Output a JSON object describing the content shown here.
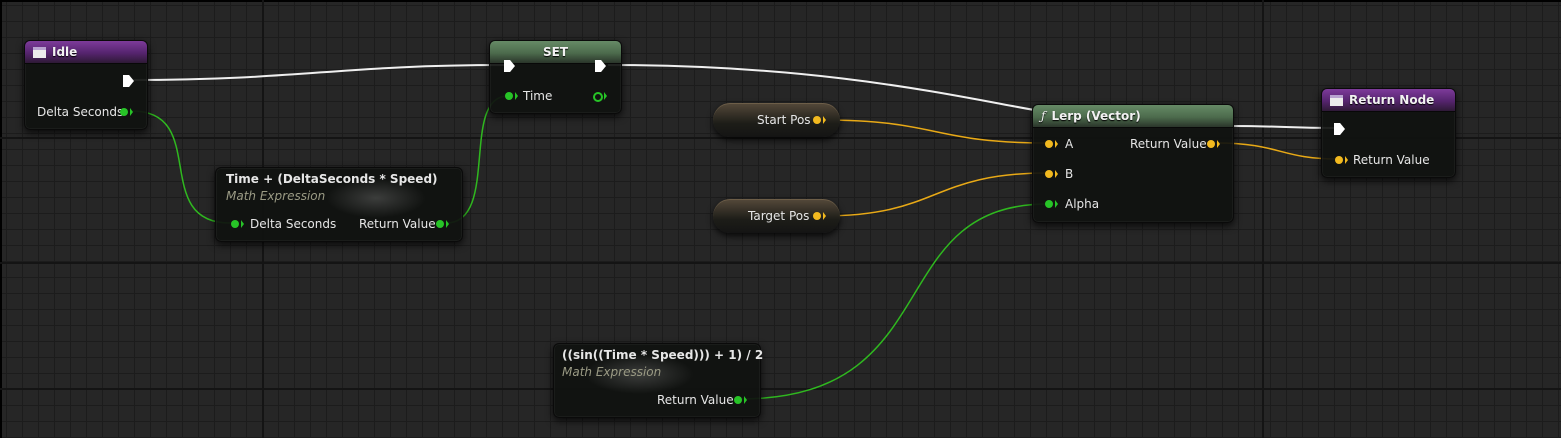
{
  "nodes": {
    "idle": {
      "title": "Idle",
      "pins": {
        "delta_seconds": "Delta Seconds"
      }
    },
    "set": {
      "title": "SET",
      "pins": {
        "time": "Time"
      }
    },
    "math_expr_1": {
      "title": "Time + (DeltaSeconds * Speed)",
      "subtitle": "Math Expression",
      "pins": {
        "delta_seconds": "Delta Seconds",
        "return_value": "Return Value"
      }
    },
    "start_pos": {
      "label": "Start Pos"
    },
    "target_pos": {
      "label": "Target Pos"
    },
    "lerp": {
      "title": "Lerp (Vector)",
      "icon": "function-icon",
      "pins": {
        "a": "A",
        "b": "B",
        "alpha": "Alpha",
        "return_value": "Return Value"
      }
    },
    "return_node": {
      "title": "Return Node",
      "pins": {
        "return_value": "Return Value"
      }
    },
    "math_expr_2": {
      "title": "((sin((Time * Speed))) + 1) / 2",
      "subtitle": "Math Expression",
      "pins": {
        "return_value": "Return Value"
      }
    }
  },
  "colors": {
    "exec_wire": "#ffffff",
    "float_wire": "#2fb81f",
    "vector_wire": "#e8a916",
    "function_header": "#4c6b4c",
    "event_header": "#55246e"
  }
}
